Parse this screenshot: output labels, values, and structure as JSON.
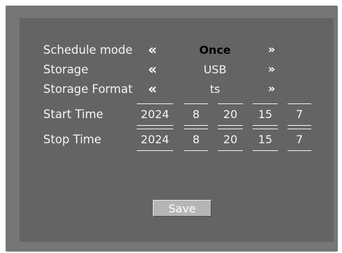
{
  "schedule": {
    "label": "Schedule mode",
    "value": "Once",
    "prev_icon": "double-chevron-left",
    "next_icon": "double-chevron-right",
    "prev_glyph": "«",
    "next_glyph": "»"
  },
  "storage": {
    "label": "Storage",
    "value": "USB",
    "prev_glyph": "«",
    "next_glyph": "»"
  },
  "storage_format": {
    "label": "Storage Format",
    "value": "ts",
    "prev_glyph": "«",
    "next_glyph": "»"
  },
  "start_time": {
    "label": "Start Time",
    "year": "2024",
    "month": "8",
    "day": "20",
    "hour": "15",
    "minute": "7"
  },
  "stop_time": {
    "label": "Stop Time",
    "year": "2024",
    "month": "8",
    "day": "20",
    "hour": "15",
    "minute": "7"
  },
  "save_label": "Save"
}
